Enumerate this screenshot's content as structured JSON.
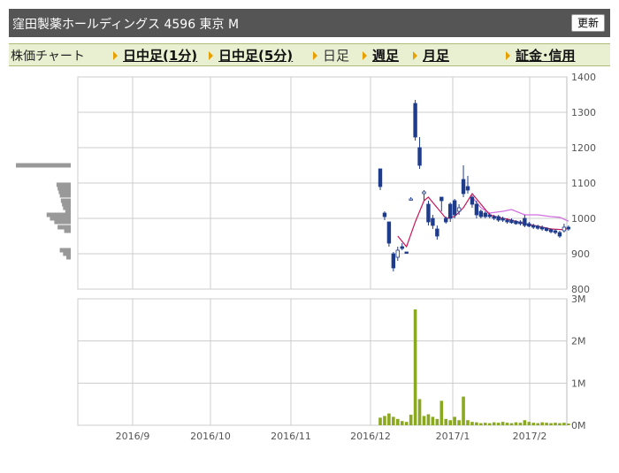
{
  "header": {
    "title": "窪田製薬ホールディングス 4596 東京 M",
    "refresh_label": "更新"
  },
  "tabs": {
    "label": "株価チャート",
    "items": [
      {
        "label": "日中足(1分)",
        "active": true
      },
      {
        "label": "日中足(5分)",
        "active": true
      },
      {
        "label": "日足",
        "active": false
      },
      {
        "label": "週足",
        "active": true
      },
      {
        "label": "月足",
        "active": true
      },
      {
        "label": "証金･信用",
        "active": true
      }
    ]
  },
  "colors": {
    "candle": "#1f3c8c",
    "ma_short": "#c8185a",
    "ma_long": "#d270e0",
    "volume": "#8aa820",
    "profile": "#999999",
    "grid": "#cccccc"
  },
  "chart_data": [
    {
      "type": "candlestick",
      "title": "",
      "ylim": [
        800,
        1400
      ],
      "yticks": [
        "1400",
        "1300",
        "1200",
        "1100",
        "1000",
        "900",
        "800"
      ],
      "xticks": [
        "2016/9",
        "2016/10",
        "2016/11",
        "2016/12",
        "2017/1",
        "2017/2"
      ],
      "candles": [
        {
          "x": 0,
          "o": 1140,
          "h": 1140,
          "l": 1080,
          "c": 1090
        },
        {
          "x": 1,
          "o": 1015,
          "h": 1020,
          "l": 995,
          "c": 1005
        },
        {
          "x": 2,
          "o": 990,
          "h": 990,
          "l": 920,
          "c": 930
        },
        {
          "x": 3,
          "o": 900,
          "h": 905,
          "l": 850,
          "c": 860
        },
        {
          "x": 4,
          "o": 890,
          "h": 920,
          "l": 880,
          "c": 910
        },
        {
          "x": 5,
          "o": 920,
          "h": 930,
          "l": 910,
          "c": 915
        },
        {
          "x": 6,
          "o": 905,
          "h": 905,
          "l": 900,
          "c": 902
        },
        {
          "x": 7,
          "o": 1055,
          "h": 1060,
          "l": 1050,
          "c": 1055
        },
        {
          "x": 8,
          "o": 1325,
          "h": 1335,
          "l": 1220,
          "c": 1230
        },
        {
          "x": 9,
          "o": 1200,
          "h": 1230,
          "l": 1140,
          "c": 1150
        },
        {
          "x": 10,
          "o": 1070,
          "h": 1080,
          "l": 1050,
          "c": 1075
        },
        {
          "x": 11,
          "o": 1040,
          "h": 1050,
          "l": 980,
          "c": 990
        },
        {
          "x": 12,
          "o": 1000,
          "h": 1010,
          "l": 970,
          "c": 980
        },
        {
          "x": 13,
          "o": 970,
          "h": 980,
          "l": 940,
          "c": 950
        },
        {
          "x": 14,
          "o": 1060,
          "h": 1060,
          "l": 1020,
          "c": 1050
        },
        {
          "x": 15,
          "o": 1000,
          "h": 1005,
          "l": 985,
          "c": 990
        },
        {
          "x": 16,
          "o": 1040,
          "h": 1045,
          "l": 990,
          "c": 1000
        },
        {
          "x": 17,
          "o": 1050,
          "h": 1055,
          "l": 1000,
          "c": 1010
        },
        {
          "x": 18,
          "o": 1020,
          "h": 1040,
          "l": 1010,
          "c": 1030
        },
        {
          "x": 19,
          "o": 1110,
          "h": 1150,
          "l": 1060,
          "c": 1070
        },
        {
          "x": 20,
          "o": 1090,
          "h": 1120,
          "l": 1070,
          "c": 1080
        },
        {
          "x": 21,
          "o": 1060,
          "h": 1065,
          "l": 1030,
          "c": 1040
        },
        {
          "x": 22,
          "o": 1040,
          "h": 1050,
          "l": 1000,
          "c": 1010
        },
        {
          "x": 23,
          "o": 1020,
          "h": 1025,
          "l": 1000,
          "c": 1005
        },
        {
          "x": 24,
          "o": 1015,
          "h": 1020,
          "l": 1000,
          "c": 1005
        },
        {
          "x": 25,
          "o": 1010,
          "h": 1015,
          "l": 1000,
          "c": 1005
        },
        {
          "x": 26,
          "o": 1005,
          "h": 1010,
          "l": 995,
          "c": 1000
        },
        {
          "x": 27,
          "o": 1005,
          "h": 1010,
          "l": 990,
          "c": 995
        },
        {
          "x": 28,
          "o": 1000,
          "h": 1005,
          "l": 990,
          "c": 995
        },
        {
          "x": 29,
          "o": 995,
          "h": 1000,
          "l": 985,
          "c": 990
        },
        {
          "x": 30,
          "o": 995,
          "h": 1000,
          "l": 985,
          "c": 988
        },
        {
          "x": 31,
          "o": 992,
          "h": 995,
          "l": 982,
          "c": 985
        },
        {
          "x": 32,
          "o": 990,
          "h": 995,
          "l": 980,
          "c": 985
        },
        {
          "x": 33,
          "o": 1000,
          "h": 1010,
          "l": 975,
          "c": 980
        },
        {
          "x": 34,
          "o": 985,
          "h": 990,
          "l": 975,
          "c": 978
        },
        {
          "x": 35,
          "o": 980,
          "h": 985,
          "l": 970,
          "c": 975
        },
        {
          "x": 36,
          "o": 978,
          "h": 982,
          "l": 968,
          "c": 972
        },
        {
          "x": 37,
          "o": 975,
          "h": 980,
          "l": 965,
          "c": 970
        },
        {
          "x": 38,
          "o": 972,
          "h": 975,
          "l": 962,
          "c": 966
        },
        {
          "x": 39,
          "o": 968,
          "h": 972,
          "l": 958,
          "c": 962
        },
        {
          "x": 40,
          "o": 965,
          "h": 970,
          "l": 955,
          "c": 960
        },
        {
          "x": 41,
          "o": 960,
          "h": 965,
          "l": 945,
          "c": 950
        },
        {
          "x": 42,
          "o": 965,
          "h": 985,
          "l": 960,
          "c": 975
        },
        {
          "x": 43,
          "o": 975,
          "h": 980,
          "l": 965,
          "c": 970
        }
      ],
      "ma_short": [
        [
          4,
          950
        ],
        [
          6,
          920
        ],
        [
          8,
          990
        ],
        [
          10,
          1050
        ],
        [
          11,
          1060
        ],
        [
          13,
          1030
        ],
        [
          15,
          1000
        ],
        [
          17,
          1005
        ],
        [
          19,
          1030
        ],
        [
          21,
          1070
        ],
        [
          23,
          1040
        ],
        [
          25,
          1010
        ],
        [
          27,
          1003
        ],
        [
          30,
          995
        ],
        [
          33,
          985
        ],
        [
          36,
          978
        ],
        [
          39,
          970
        ],
        [
          42,
          968
        ],
        [
          43,
          972
        ]
      ],
      "ma_long": [
        [
          21,
          1060
        ],
        [
          23,
          1030
        ],
        [
          25,
          1015
        ],
        [
          28,
          1020
        ],
        [
          30,
          1025
        ],
        [
          33,
          1010
        ],
        [
          36,
          1010
        ],
        [
          39,
          1005
        ],
        [
          41,
          1003
        ],
        [
          43,
          992
        ]
      ],
      "price_profile": [
        {
          "price": 1150,
          "amount": 100
        },
        {
          "price": 1095,
          "amount": 26
        },
        {
          "price": 1085,
          "amount": 24
        },
        {
          "price": 1075,
          "amount": 22
        },
        {
          "price": 1065,
          "amount": 20
        },
        {
          "price": 1050,
          "amount": 18
        },
        {
          "price": 1040,
          "amount": 16
        },
        {
          "price": 1030,
          "amount": 14
        },
        {
          "price": 1020,
          "amount": 10
        },
        {
          "price": 1010,
          "amount": 44
        },
        {
          "price": 1000,
          "amount": 38
        },
        {
          "price": 990,
          "amount": 30
        },
        {
          "price": 975,
          "amount": 24
        },
        {
          "price": 965,
          "amount": 12
        },
        {
          "price": 910,
          "amount": 20
        },
        {
          "price": 900,
          "amount": 14
        },
        {
          "price": 890,
          "amount": 8
        }
      ]
    },
    {
      "type": "bar",
      "title": "",
      "ylim": [
        0,
        3
      ],
      "yticks": [
        "3M",
        "2M",
        "1M",
        "0M"
      ],
      "xticks": [
        "2016/9",
        "2016/10",
        "2016/11",
        "2016/12",
        "2017/1",
        "2017/2"
      ],
      "volume_millions": [
        0.18,
        0.22,
        0.28,
        0.2,
        0.15,
        0.1,
        0.08,
        0.25,
        2.75,
        0.62,
        0.22,
        0.26,
        0.2,
        0.15,
        0.58,
        0.15,
        0.12,
        0.2,
        0.12,
        0.68,
        0.12,
        0.08,
        0.07,
        0.05,
        0.06,
        0.05,
        0.07,
        0.06,
        0.08,
        0.06,
        0.05,
        0.07,
        0.06,
        0.12,
        0.08,
        0.06,
        0.05,
        0.07,
        0.06,
        0.05,
        0.06,
        0.05,
        0.06,
        0.04
      ]
    }
  ]
}
